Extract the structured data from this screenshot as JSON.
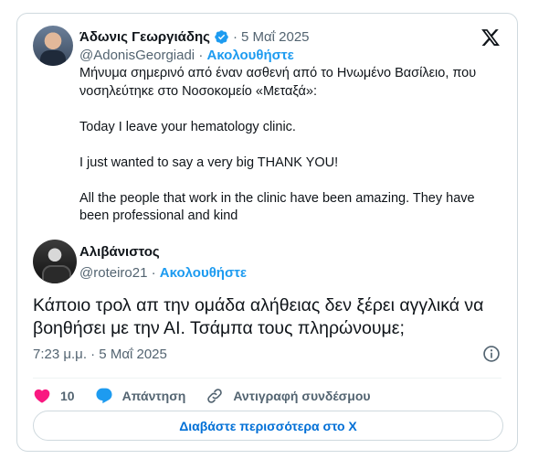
{
  "quoted_tweet": {
    "author_name": "Άδωνις Γεωργιάδης",
    "separator": "·",
    "date": "5 Μαΐ 2025",
    "handle": "@AdonisGeorgiadi",
    "handle_separator": "·",
    "follow_label": "Ακολουθήστε",
    "body": [
      "Μήνυμα σημερινό από έναν ασθενή από το Ηνωμένο Βασίλειο, που νοσηλεύτηκε στο Νοσοκομείο «Μεταξά»:",
      "Today I leave your hematology clinic.",
      "I just wanted to say a very big THANK YOU!",
      "All the people that work in the clinic have been amazing. They have been professional and kind"
    ]
  },
  "main_tweet": {
    "author_name": "Αλιβάνιστος",
    "handle": "@roteiro21",
    "handle_separator": "·",
    "follow_label": "Ακολουθήστε",
    "text": "Κάποιο τρολ απ την ομάδα αλήθειας δεν ξέρει αγγλικά να βοηθήσει με την ΑΙ. Τσάμπα τους πληρώνουμε;",
    "timestamp": "7:23 μ.μ. · 5 Μαΐ 2025"
  },
  "actions": {
    "like_count": "10",
    "reply_label": "Απάντηση",
    "copy_link_label": "Αντιγραφή συνδέσμου"
  },
  "read_more_label": "Διαβάστε περισσότερα στο X",
  "colors": {
    "accent": "#1d9bf0",
    "like": "#f91880",
    "secondary_text": "#536471",
    "border": "#cfd9de"
  },
  "icons": [
    "verified-badge-icon",
    "x-logo-icon",
    "info-icon",
    "heart-icon",
    "reply-bubble-icon",
    "link-icon"
  ]
}
